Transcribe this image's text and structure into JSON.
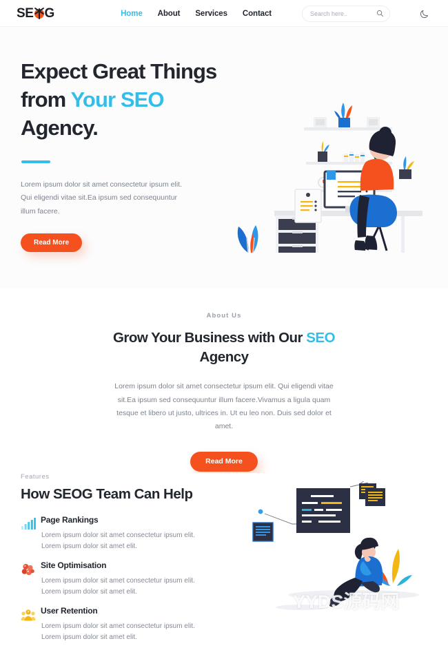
{
  "brand": {
    "name_part1": "SE",
    "name_part2": "G",
    "logo_icon": "bug-icon",
    "accent_color": "#35bdea",
    "cta_color": "#f4511e",
    "logo_mark_color": "#ef5523"
  },
  "header": {
    "nav": [
      {
        "label": "Home",
        "active": true
      },
      {
        "label": "About",
        "active": false
      },
      {
        "label": "Services",
        "active": false
      },
      {
        "label": "Contact",
        "active": false
      }
    ],
    "search": {
      "placeholder": "Search here..",
      "value": "",
      "icon": "search-icon"
    },
    "theme_toggle": {
      "icon": "moon-icon",
      "label": "Dark mode"
    }
  },
  "hero": {
    "title_line1": "Expect Great Things",
    "title_line2_plain": "from ",
    "title_line2_accent": "Your SEO",
    "title_line3": "Agency.",
    "paragraph": "Lorem ipsum dolor sit amet consectetur ipsum elit. Qui eligendi vitae sit.Ea ipsum sed consequuntur illum facere.",
    "cta_label": "Read More",
    "illustration": "person-at-desk-workspace-illustration"
  },
  "about": {
    "eyebrow": "About Us",
    "title_plain1": "Grow Your Business with Our ",
    "title_accent": "SEO",
    "title_plain2": " Agency",
    "paragraph": "Lorem ipsum dolor sit amet consectetur ipsum elit. Qui eligendi vitae sit.Ea ipsum sed consequuntur illum facere.Vivamus a ligula quam tesque et libero ut justo, ultrices in. Ut eu leo non. Duis sed dolor et amet.",
    "cta_label": "Read More"
  },
  "features": {
    "eyebrow": "Features",
    "title": "How SEOG Team Can Help",
    "items": [
      {
        "icon": "bar-chart-icon",
        "icon_color": "#35bdea",
        "name": "Page Rankings",
        "desc": "Lorem ipsum dolor sit amet consectetur ipsum elit. Lorem ipsum dolor sit amet elit."
      },
      {
        "icon": "molecule-cluster-icon",
        "icon_color": "#e8503a",
        "name": "Site Optimisation",
        "desc": "Lorem ipsum dolor sit amet consectetur ipsum elit. Lorem ipsum dolor sit amet elit."
      },
      {
        "icon": "user-group-icon",
        "icon_color": "#f3b714",
        "name": "User Retention",
        "desc": "Lorem ipsum dolor sit amet consectetur ipsum elit. Lorem ipsum dolor sit amet elit."
      }
    ],
    "illustration": "person-with-code-windows-illustration"
  },
  "watermark": {
    "text": "YYDS源码网"
  }
}
